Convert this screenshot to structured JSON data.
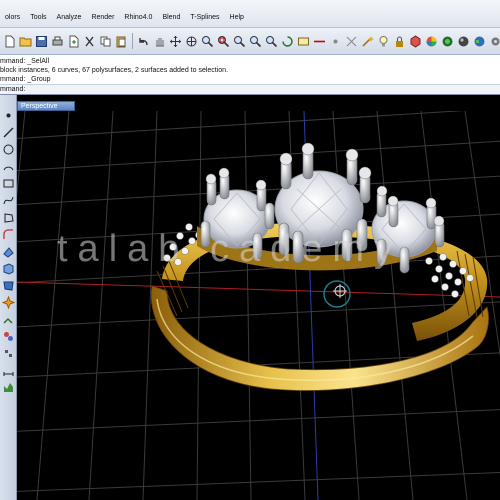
{
  "menu": {
    "items": [
      "olors",
      "Tools",
      "Analyze",
      "Render",
      "Rhino4.0",
      "Blend",
      "T-Splines",
      "Help"
    ]
  },
  "toolbar": {
    "icons": [
      "new-file-icon",
      "open-folder-icon",
      "save-icon",
      "print-icon",
      "import-icon",
      "cut-icon",
      "copy-icon",
      "paste-icon",
      "undo-icon",
      "pan-hand-icon",
      "move-icon",
      "rotate-view-icon",
      "zoom-icon",
      "zoom-window-icon",
      "zoom-selected-icon",
      "zoom-extents-icon",
      "zoom-target-icon",
      "orbit-icon",
      "named-view-icon",
      "cplane-icon",
      "grid-icon",
      "snap-icon",
      "magic-icon",
      "light-bulb-icon",
      "lock-icon",
      "render-material-icon",
      "color-wheel-icon",
      "render-preview-icon",
      "sphere-icon",
      "globe-icon",
      "settings-icon"
    ]
  },
  "command_history": {
    "line1": "mmand: _SelAll",
    "line2": "block instances, 6 curves, 67 polysurfaces, 2 surfaces added to selection.",
    "line3": "mmand: _Group"
  },
  "command_prompt": "mmand:",
  "viewport": {
    "title": "Perspective"
  },
  "left_tools": [
    "point-icon",
    "line-icon",
    "circle-icon",
    "arc-icon",
    "rectangle-icon",
    "curve-icon",
    "polygon-icon",
    "fillet-icon",
    "surface-icon",
    "solid-icon",
    "mesh-icon",
    "explode-icon",
    "join-icon",
    "transform-icon",
    "array-icon",
    "dimension-icon",
    "analyze-icon"
  ],
  "watermark_text": "talab cademy",
  "colors": {
    "viewport_bg": "#000000",
    "grid": "#3a3a3a",
    "gold": "#d4a72c",
    "x_axis": "#b02020"
  }
}
